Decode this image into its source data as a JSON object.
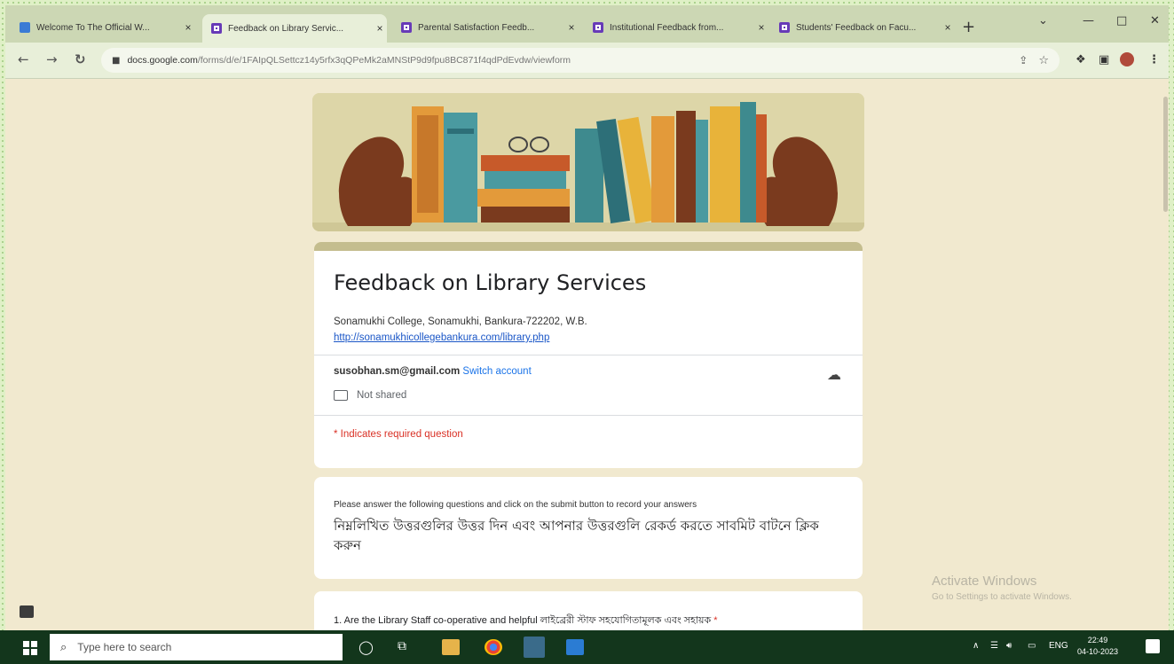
{
  "browser": {
    "tabs": [
      {
        "title": "Welcome To The Official W...",
        "active": false,
        "favicon": "site-favicon-blue"
      },
      {
        "title": "Feedback on Library Servic...",
        "active": true,
        "favicon": "google-forms-icon"
      },
      {
        "title": "Parental Satisfaction Feedb...",
        "active": false,
        "favicon": "google-forms-icon"
      },
      {
        "title": "Institutional Feedback from...",
        "active": false,
        "favicon": "google-forms-icon"
      },
      {
        "title": "Students' Feedback on Facu...",
        "active": false,
        "favicon": "google-forms-icon"
      }
    ],
    "close_glyph": "×",
    "newtab_glyph": "+",
    "url_host": "docs.google.com",
    "url_path": "/forms/d/e/1FAIpQLSettcz14y5rfx3qQPeMk2aMNStP9d9fpu8BC871f4qdPdEvdw/viewform"
  },
  "form": {
    "title": "Feedback on Library Services",
    "description": "Sonamukhi College, Sonamukhi, Bankura-722202, W.B.",
    "link": "http://sonamukhicollegebankura.com/library.php",
    "account_email": "susobhan.sm@gmail.com",
    "switch_account": "Switch account",
    "not_shared": "Not shared",
    "required_note": "* Indicates required question",
    "instruction_en": "Please answer the following questions and click on the submit button to record your answers",
    "instruction_bn": "নিম্নলিখিত উত্তরগুলির উত্তর দিন এবং আপনার উত্তরগুলি রেকর্ড করতে সাবমিট বাটনে ক্লিক করুন",
    "q1_text": "1. Are the Library Staff co-operative and helpful লাইব্রেরী স্টাফ সহযোগিতামূলক এবং সহায়ক",
    "q1_required": "*"
  },
  "watermark": {
    "line1": "Activate Windows",
    "line2": "Go to Settings to activate Windows."
  },
  "taskbar": {
    "search_placeholder": "Type here to search",
    "lang": "ENG",
    "time": "22:49",
    "date": "04-10-2023"
  },
  "colors": {
    "forms_purple": "#673ab7",
    "page_bg": "#f1e9cf",
    "header_accent": "#c4bd8e",
    "required_red": "#d93025",
    "link_blue": "#1a56c7"
  }
}
